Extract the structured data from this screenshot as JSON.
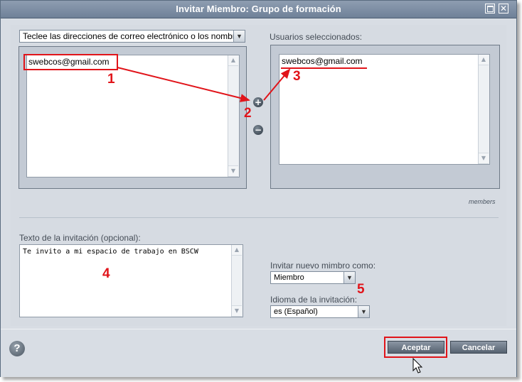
{
  "window": {
    "title": "Invitar Miembro: Grupo de formación"
  },
  "left": {
    "dropdown_value": "Teclee las direcciones de correo electrónico o los nombres",
    "emails": [
      "swebcos@gmail.com"
    ]
  },
  "right": {
    "label": "Usuarios seleccionados:",
    "emails": [
      "swebcos@gmail.com"
    ],
    "members_link": "members"
  },
  "invitation": {
    "label": "Texto de la invitación (opcional):",
    "text": "Te invito a mi espacio de trabajo en BSCW"
  },
  "invite_as": {
    "label": "Invitar nuevo mimbro como:",
    "value": "Miembro"
  },
  "language": {
    "label": "Idioma de la invitación:",
    "value": "es (Español)"
  },
  "footer": {
    "accept_label": "Aceptar",
    "cancel_label": "Cancelar",
    "help_symbol": "?"
  },
  "annotations": {
    "n1": "1",
    "n2": "2",
    "n3": "3",
    "n4": "4",
    "n5": "5"
  },
  "colors": {
    "annotation_red": "#e1141a",
    "titlebar": "#7d8da3"
  }
}
